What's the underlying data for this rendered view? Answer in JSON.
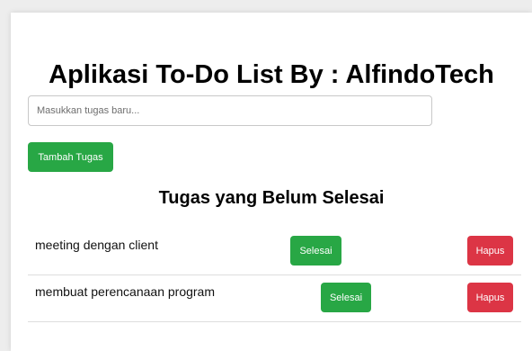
{
  "app": {
    "title": "Aplikasi To-Do List By : AlfindoTech"
  },
  "form": {
    "placeholder": "Masukkan tugas baru...",
    "value": "",
    "add_label": "Tambah Tugas"
  },
  "pending": {
    "heading": "Tugas yang Belum Selesai",
    "tasks": [
      {
        "name": "meeting dengan client",
        "done_label": "Selesai",
        "delete_label": "Hapus"
      },
      {
        "name": "membuat perencanaan program",
        "done_label": "Selesai",
        "delete_label": "Hapus"
      }
    ]
  },
  "colors": {
    "success": "#28a745",
    "danger": "#dc3545"
  }
}
